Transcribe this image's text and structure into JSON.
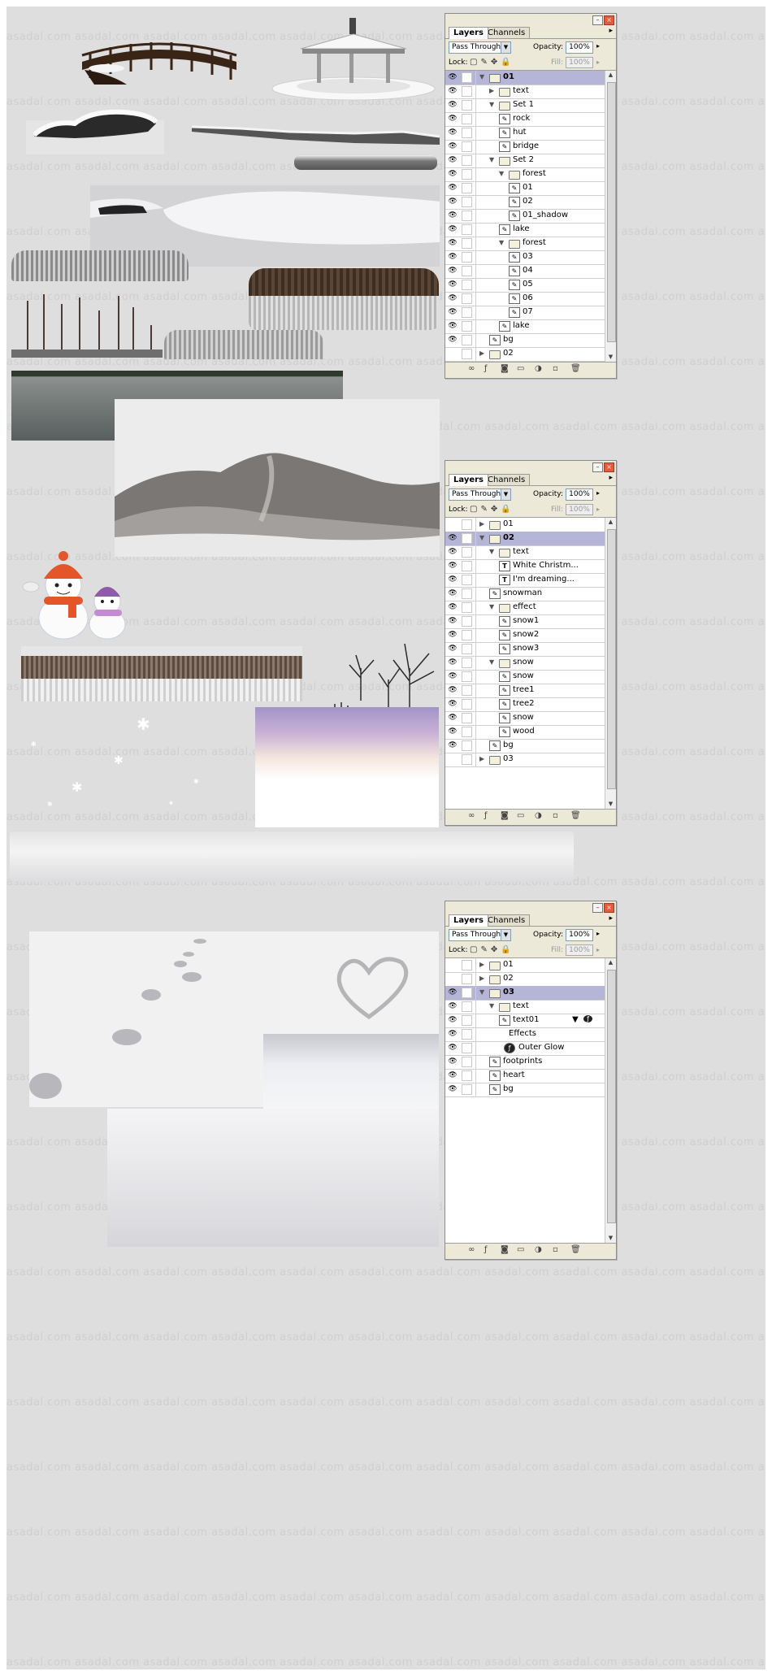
{
  "watermark": "asadal.com",
  "panel_common": {
    "tab_layers": "Layers",
    "tab_channels": "Channels",
    "blend_mode": "Pass Through",
    "opacity_label": "Opacity:",
    "opacity_value": "100%",
    "lock_label": "Lock:",
    "fill_label": "Fill:",
    "fill_value": "100%"
  },
  "panels": [
    {
      "rows": [
        {
          "label": "01",
          "kind": "folder",
          "indent": 0,
          "open": true,
          "selected": true,
          "eye": true
        },
        {
          "label": "text",
          "kind": "folder",
          "indent": 1,
          "open": false,
          "eye": true
        },
        {
          "label": "Set 1",
          "kind": "folder",
          "indent": 1,
          "open": true,
          "eye": true
        },
        {
          "label": "rock",
          "kind": "layer",
          "indent": 2,
          "eye": true
        },
        {
          "label": "hut",
          "kind": "layer",
          "indent": 2,
          "eye": true
        },
        {
          "label": "bridge",
          "kind": "layer",
          "indent": 2,
          "eye": true
        },
        {
          "label": "Set 2",
          "kind": "folder",
          "indent": 1,
          "open": true,
          "eye": true
        },
        {
          "label": "forest",
          "kind": "folder",
          "indent": 2,
          "open": true,
          "eye": true
        },
        {
          "label": "01",
          "kind": "layer",
          "indent": 3,
          "eye": true
        },
        {
          "label": "02",
          "kind": "layer",
          "indent": 3,
          "eye": true
        },
        {
          "label": "01_shadow",
          "kind": "layer",
          "indent": 3,
          "eye": true
        },
        {
          "label": "lake",
          "kind": "layer",
          "indent": 2,
          "eye": true
        },
        {
          "label": "forest",
          "kind": "folder",
          "indent": 2,
          "open": true,
          "eye": true
        },
        {
          "label": "03",
          "kind": "layer",
          "indent": 3,
          "eye": true
        },
        {
          "label": "04",
          "kind": "layer",
          "indent": 3,
          "eye": true
        },
        {
          "label": "05",
          "kind": "layer",
          "indent": 3,
          "eye": true
        },
        {
          "label": "06",
          "kind": "layer",
          "indent": 3,
          "eye": true
        },
        {
          "label": "07",
          "kind": "layer",
          "indent": 3,
          "eye": true
        },
        {
          "label": "lake",
          "kind": "layer",
          "indent": 2,
          "eye": true
        },
        {
          "label": "bg",
          "kind": "layer",
          "indent": 1,
          "eye": true
        },
        {
          "label": "02",
          "kind": "folder",
          "indent": 0,
          "open": false,
          "eye": false
        }
      ]
    },
    {
      "rows": [
        {
          "label": "01",
          "kind": "folder",
          "indent": 0,
          "open": false,
          "eye": false
        },
        {
          "label": "02",
          "kind": "folder",
          "indent": 0,
          "open": true,
          "selected": true,
          "eye": true
        },
        {
          "label": "text",
          "kind": "folder",
          "indent": 1,
          "open": true,
          "eye": true
        },
        {
          "label": "White Christm...",
          "kind": "text",
          "indent": 2,
          "eye": true
        },
        {
          "label": "I'm dreaming...",
          "kind": "text",
          "indent": 2,
          "eye": true
        },
        {
          "label": "snowman",
          "kind": "layer",
          "indent": 1,
          "eye": true
        },
        {
          "label": "effect",
          "kind": "folder",
          "indent": 1,
          "open": true,
          "eye": true
        },
        {
          "label": "snow1",
          "kind": "layer",
          "indent": 2,
          "eye": true
        },
        {
          "label": "snow2",
          "kind": "layer",
          "indent": 2,
          "eye": true
        },
        {
          "label": "snow3",
          "kind": "layer",
          "indent": 2,
          "eye": true
        },
        {
          "label": "snow",
          "kind": "folder",
          "indent": 1,
          "open": true,
          "eye": true
        },
        {
          "label": "snow",
          "kind": "layer",
          "indent": 2,
          "eye": true
        },
        {
          "label": "tree1",
          "kind": "layer",
          "indent": 2,
          "eye": true
        },
        {
          "label": "tree2",
          "kind": "layer",
          "indent": 2,
          "eye": true
        },
        {
          "label": "snow",
          "kind": "layer",
          "indent": 2,
          "eye": true
        },
        {
          "label": "wood",
          "kind": "layer",
          "indent": 2,
          "eye": true
        },
        {
          "label": "bg",
          "kind": "layer",
          "indent": 1,
          "eye": true
        },
        {
          "label": "03",
          "kind": "folder",
          "indent": 0,
          "open": false,
          "eye": false
        }
      ]
    },
    {
      "rows": [
        {
          "label": "01",
          "kind": "folder",
          "indent": 0,
          "open": false,
          "eye": false
        },
        {
          "label": "02",
          "kind": "folder",
          "indent": 0,
          "open": false,
          "eye": false
        },
        {
          "label": "03",
          "kind": "folder",
          "indent": 0,
          "open": true,
          "selected": true,
          "eye": true
        },
        {
          "label": "text",
          "kind": "folder",
          "indent": 1,
          "open": true,
          "eye": true
        },
        {
          "label": "text01",
          "kind": "layer",
          "indent": 2,
          "eye": true,
          "fx": true
        },
        {
          "label": "Effects",
          "kind": "effects",
          "indent": 2,
          "eye": true
        },
        {
          "label": "Outer Glow",
          "kind": "effect",
          "indent": 3,
          "eye": true
        },
        {
          "label": "footprints",
          "kind": "layer",
          "indent": 1,
          "eye": true
        },
        {
          "label": "heart",
          "kind": "layer",
          "indent": 1,
          "eye": true
        },
        {
          "label": "bg",
          "kind": "layer",
          "indent": 1,
          "eye": true
        }
      ]
    }
  ]
}
